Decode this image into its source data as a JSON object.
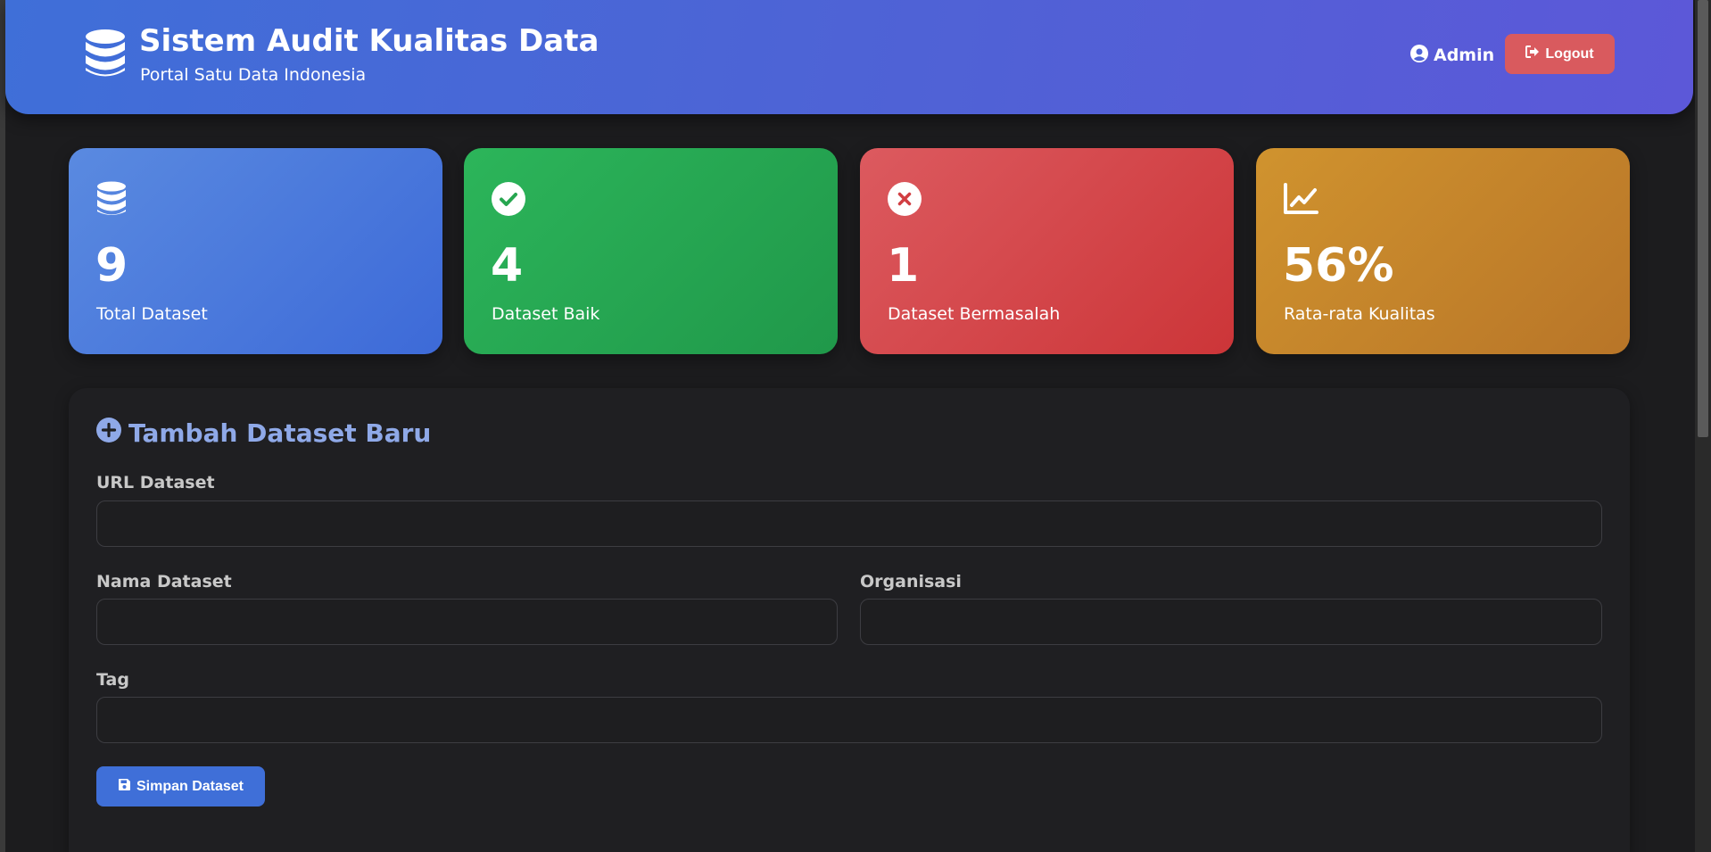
{
  "header": {
    "title": "Sistem Audit Kualitas Data",
    "subtitle": "Portal Satu Data Indonesia",
    "brand_icon": "database-icon",
    "user_label": "Admin",
    "user_icon": "user-circle-icon",
    "logout_label": "Logout",
    "logout_icon": "sign-out-icon"
  },
  "stats": [
    {
      "value": "9",
      "label": "Total Dataset",
      "icon": "database-icon",
      "color": "#4a7be0"
    },
    {
      "value": "4",
      "label": "Dataset Baik",
      "icon": "check-circle-icon",
      "color": "#28a952"
    },
    {
      "value": "1",
      "label": "Dataset Bermasalah",
      "icon": "times-circle-icon",
      "color": "#d44246"
    },
    {
      "value": "56%",
      "label": "Rata-rata Kualitas",
      "icon": "chart-line-icon",
      "color": "#c4842b"
    }
  ],
  "form": {
    "title": "Tambah Dataset Baru",
    "title_icon": "plus-circle-icon",
    "fields": {
      "url": {
        "label": "URL Dataset",
        "value": ""
      },
      "name": {
        "label": "Nama Dataset",
        "value": ""
      },
      "organization": {
        "label": "Organisasi",
        "value": ""
      },
      "tag": {
        "label": "Tag",
        "value": ""
      }
    },
    "submit_label": "Simpan Dataset",
    "submit_icon": "save-icon"
  },
  "colors": {
    "header_start": "#3f6fd8",
    "header_end": "#5c58d8",
    "logout": "#d95a5e",
    "accent": "#3f6fd8",
    "form_title": "#8fa9e8",
    "background": "#1c1c1e"
  }
}
